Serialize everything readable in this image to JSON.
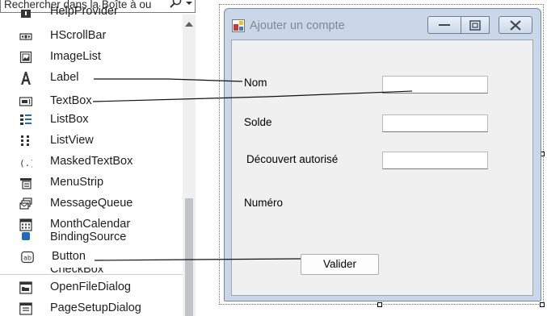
{
  "toolbox": {
    "search_placeholder": "Rechercher dans la Boîte à ou",
    "items": [
      {
        "label": "HelpProvider",
        "icon": "help-provider-icon"
      },
      {
        "label": "HScrollBar",
        "icon": "hscrollbar-icon"
      },
      {
        "label": "ImageList",
        "icon": "imagelist-icon"
      },
      {
        "label": "Label",
        "icon": "label-icon"
      },
      {
        "label": "TextBox",
        "icon": "textbox-icon"
      },
      {
        "label": "ListBox",
        "icon": "listbox-icon"
      },
      {
        "label": "ListView",
        "icon": "listview-icon"
      },
      {
        "label": "MaskedTextBox",
        "icon": "maskedtextbox-icon"
      },
      {
        "label": "MenuStrip",
        "icon": "menustrip-icon"
      },
      {
        "label": "MessageQueue",
        "icon": "messagequeue-icon"
      },
      {
        "label": "MonthCalendar",
        "icon": "monthcalendar-icon"
      },
      {
        "label": "BindingSource",
        "icon": "bindingsource-icon"
      },
      {
        "label": "Button",
        "icon": "button-icon"
      },
      {
        "label": "CheckBox",
        "icon": "checkbox-icon"
      },
      {
        "label": "OpenFileDialog",
        "icon": "openfiledialog-icon"
      },
      {
        "label": "PageSetupDialog",
        "icon": "pagesetupdialog-icon"
      }
    ]
  },
  "form": {
    "title": "Ajouter un compte",
    "labels": {
      "nom": "Nom",
      "solde": "Solde",
      "decouvert": "Découvert autorisé",
      "numero": "Numéro"
    },
    "button_label": "Valider"
  },
  "colors": {
    "form_frame": "#c9d7e8",
    "client_area": "#f0f0f0",
    "scroll_thumb": "#c2c3c9"
  }
}
